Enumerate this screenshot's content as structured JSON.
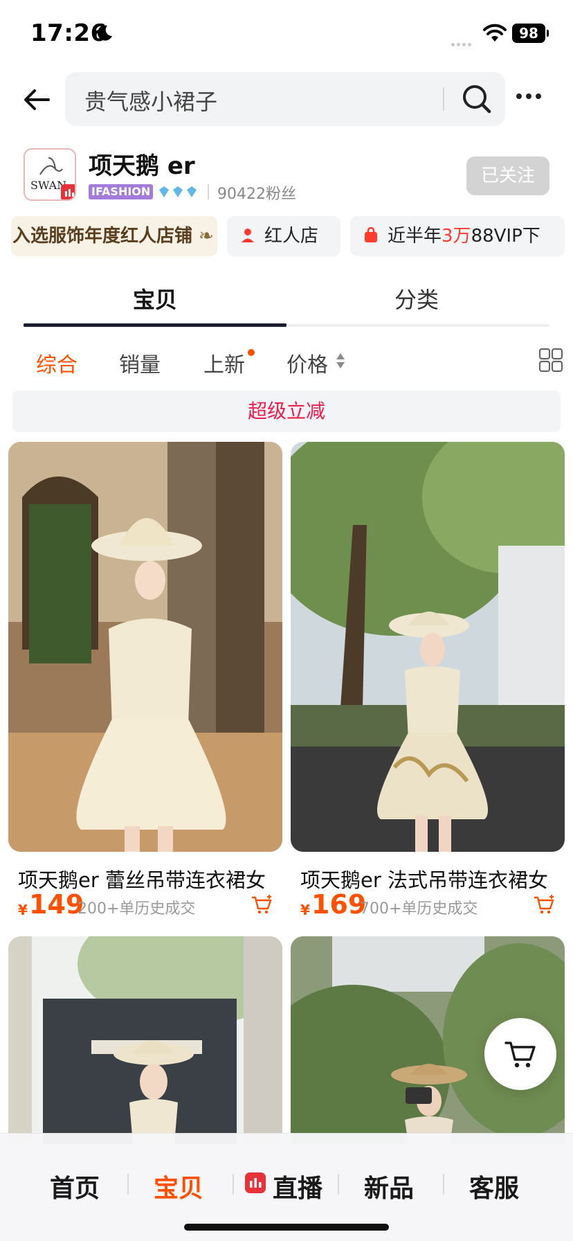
{
  "status_bar": {
    "time": "17:26",
    "battery": "98"
  },
  "search": {
    "placeholder": "贵气感小裙子"
  },
  "store": {
    "name": "项天鹅 er",
    "logo_text": "SWAN",
    "badge": "IFASHION",
    "fans": "90422粉丝",
    "follow_label": "已关注"
  },
  "chips": {
    "award": "入选服饰年度红人店铺",
    "red_store": "红人店",
    "vip_prefix": "近半年",
    "vip_highlight": "3万",
    "vip_suffix": "88VIP下"
  },
  "tabs": [
    {
      "label": "宝贝",
      "active": true
    },
    {
      "label": "分类",
      "active": false
    }
  ],
  "sort": {
    "all": "综合",
    "sales": "销量",
    "new": "上新",
    "price": "价格"
  },
  "promo": "超级立减",
  "products": [
    {
      "title": "项天鹅er 蕾丝吊带连衣裙女",
      "currency": "¥",
      "price": "149",
      "sold": "200+单历史成交"
    },
    {
      "title": "项天鹅er 法式吊带连衣裙女",
      "currency": "¥",
      "price": "169",
      "sold": "700+单历史成交"
    }
  ],
  "bottom_nav": {
    "home": "首页",
    "items": "宝贝",
    "live": "直播",
    "new": "新品",
    "service": "客服"
  },
  "colors": {
    "accent": "#ff5000",
    "promo": "#ee1c4f",
    "tab_underline": "#1b1d30"
  }
}
